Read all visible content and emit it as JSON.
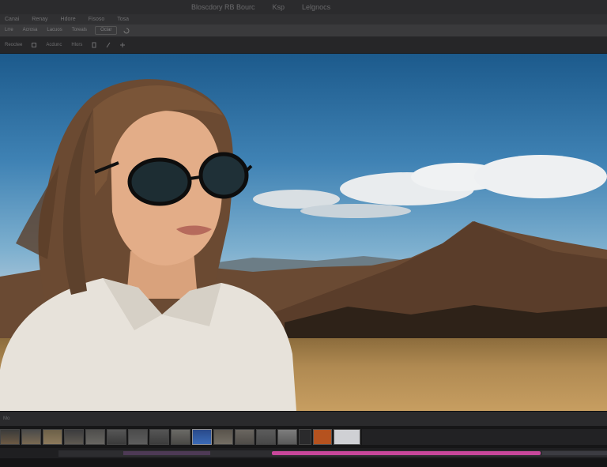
{
  "titlebar": {
    "items": [
      "Bloscdory RB Bourc",
      "Ksp",
      "Lelgnocs"
    ]
  },
  "menubar": {
    "items": [
      "Canai",
      "Renay",
      "Hdore",
      "Fisoso",
      "Tosa"
    ]
  },
  "optionsbar": {
    "items": [
      "Lrre",
      "Acrosa",
      "Lacuos",
      "Toreals"
    ],
    "button": "Oclar"
  },
  "toolstrip": {
    "items": [
      "Reoctee",
      "Acdunc",
      "Hlors"
    ]
  },
  "filmstrip": {
    "label": "Mo"
  },
  "colors": {
    "accent": "#c8479b",
    "sky": "#3f82b4",
    "chrome_dark": "#1c1c1e"
  }
}
